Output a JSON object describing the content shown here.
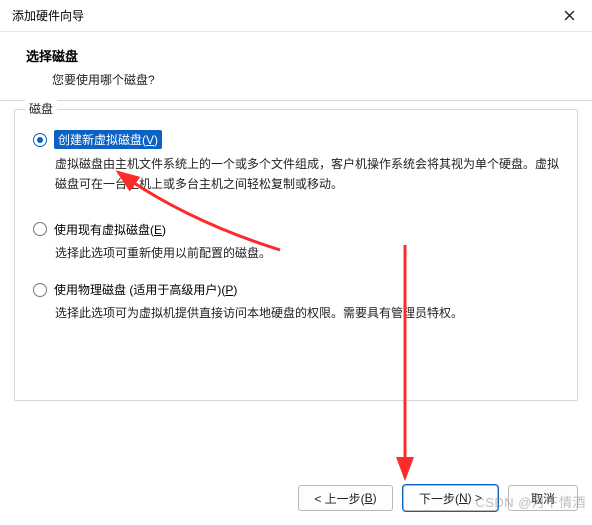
{
  "window": {
    "title": "添加硬件向导"
  },
  "header": {
    "heading": "选择磁盘",
    "sub": "您要使用哪个磁盘?"
  },
  "group": {
    "legend": "磁盘"
  },
  "options": {
    "create": {
      "label_pre": "创建新虚拟磁盘(",
      "label_mn": "V",
      "label_post": ")",
      "desc": "虚拟磁盘由主机文件系统上的一个或多个文件组成，客户机操作系统会将其视为单个硬盘。虚拟磁盘可在一台主机上或多台主机之间轻松复制或移动。"
    },
    "existing": {
      "label_pre": "使用现有虚拟磁盘(",
      "label_mn": "E",
      "label_post": ")",
      "desc": "选择此选项可重新使用以前配置的磁盘。"
    },
    "physical": {
      "label_pre": "使用物理磁盘 (适用于高级用户)(",
      "label_mn": "P",
      "label_post": ")",
      "desc": "选择此选项可为虚拟机提供直接访问本地硬盘的权限。需要具有管理员特权。"
    }
  },
  "footer": {
    "back_pre": "< 上一步(",
    "back_mn": "B",
    "back_post": ")",
    "next_pre": "下一步(",
    "next_mn": "N",
    "next_post": ") >",
    "cancel": "取消"
  },
  "watermark": "CSDN @月下情酒"
}
